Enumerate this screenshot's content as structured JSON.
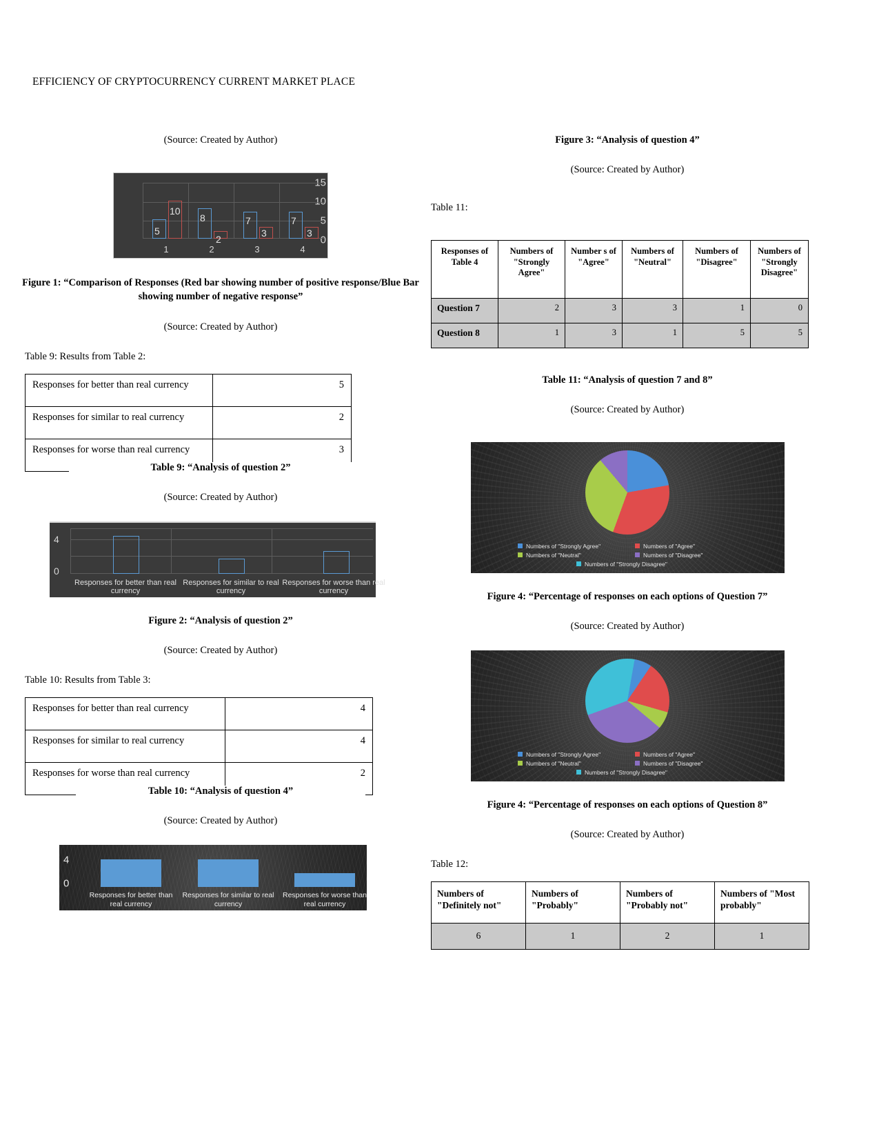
{
  "document": {
    "header": "EFFICIENCY OF CRYPTOCURRENCY CURRENT MARKET PLACE",
    "source_note": "(Source: Created by Author)"
  },
  "left": {
    "source_top": "(Source: Created by Author)",
    "figure1_caption": "Figure 1: “Comparison of Responses (Red bar showing number of positive response/Blue Bar showing number of negative response”",
    "figure1_source": "(Source: Created by Author)",
    "table9_label": "Table 9:  Results from Table 2:",
    "table9_caption": "Table 9: “Analysis of question 2”",
    "table9_source": "(Source: Created by Author)",
    "table9_rows": [
      {
        "label": "Responses for better than real currency",
        "value": "5"
      },
      {
        "label": "Responses for similar to real currency",
        "value": "2"
      },
      {
        "label": "Responses for worse than real currency",
        "value": "3"
      }
    ],
    "figure2_caption": "Figure 2: “Analysis of question 2”",
    "figure2_source": "(Source: Created by Author)",
    "table10_label": "Table 10: Results from Table 3:",
    "table10_caption": "Table 10: “Analysis of question 4”",
    "table10_source": "(Source: Created by Author)",
    "table10_rows": [
      {
        "label": "Responses for better than real currency",
        "value": "4"
      },
      {
        "label": "Responses for similar to real currency",
        "value": "4"
      },
      {
        "label": "Responses for worse than real currency",
        "value": "2"
      }
    ]
  },
  "right": {
    "figure3_title": "Figure 3: “Analysis of question 4”",
    "figure3_source": "(Source: Created by Author)",
    "table11_label": "Table 11:",
    "table11_caption": "Table 11: “Analysis of question 7 and 8”",
    "table11_source": "(Source: Created by Author)",
    "table11_headers": [
      "Responses of Table 4",
      "Numbers of \"Strongly Agree\"",
      "Number s of \"Agree\"",
      "Numbers of \"Neutral\"",
      "Numbers of \"Disagree\"",
      "Numbers of \"Strongly Disagree\""
    ],
    "table11_rows": [
      {
        "label": "Question 7",
        "values": [
          "2",
          "3",
          "3",
          "1",
          "0"
        ]
      },
      {
        "label": "Question 8",
        "values": [
          "1",
          "3",
          "1",
          "5",
          "5"
        ]
      }
    ],
    "figure4a_caption": "Figure 4: “Percentage of responses on each options of Question 7”",
    "figure4a_source": "(Source: Created by Author)",
    "figure4b_caption": "Figure 4: “Percentage of responses on each options of Question 8”",
    "figure4b_source": "(Source: Created by Author)",
    "table12_label": "Table 12:",
    "table12_headers": [
      "Numbers of \"Definitely not\"",
      "Numbers of \"Probably\"",
      "Numbers of \"Probably not\"",
      "Numbers of \"Most probably\""
    ],
    "table12_values": [
      "6",
      "1",
      "2",
      "1"
    ]
  },
  "chart_data": [
    {
      "id": "figure1",
      "type": "bar",
      "title": "Comparison of Responses",
      "categories": [
        "1",
        "2",
        "3",
        "4"
      ],
      "series": [
        {
          "name": "Blue Bar (negative response)",
          "color": "#5b9bd5",
          "values": [
            5,
            8,
            7,
            7
          ]
        },
        {
          "name": "Red bar (positive response)",
          "color": "#c0504d",
          "values": [
            10,
            2,
            3,
            3
          ]
        }
      ],
      "ylim": [
        0,
        15
      ],
      "yticks": [
        "0",
        "5",
        "10",
        "15"
      ],
      "xlabel": "",
      "ylabel": "",
      "grid": true,
      "background": "#3a3a3a"
    },
    {
      "id": "figure2",
      "type": "bar",
      "title": "Analysis of question 2",
      "categories": [
        "Responses for better than real currency",
        "Responses for similar to real currency",
        "Responses for worse than real currency"
      ],
      "values": [
        5,
        2,
        3
      ],
      "ylim": [
        0,
        6
      ],
      "yticks": [
        "0",
        "4"
      ],
      "color": "#5b9bd5",
      "grid": true,
      "background": "#3a3a3a"
    },
    {
      "id": "figure3",
      "type": "bar",
      "title": "Analysis of question 4",
      "categories": [
        "Responses for better than real currency",
        "Responses for similar to real currency",
        "Responses for worse than real currency"
      ],
      "values": [
        4,
        4,
        2
      ],
      "ylim": [
        0,
        5
      ],
      "yticks": [
        "0",
        "4"
      ],
      "color": "#5b9bd5",
      "grid": false,
      "background": "#2f2f2f"
    },
    {
      "id": "figure4a",
      "type": "pie",
      "title": "Percentage of responses on each options of Question 7",
      "labels": [
        "Numbers of \"Strongly Agree\"",
        "Numbers of \"Agree\"",
        "Numbers of \"Neutral\"",
        "Numbers of \"Disagree\"",
        "Numbers of \"Strongly Disagree\""
      ],
      "values": [
        2,
        3,
        3,
        1,
        0
      ],
      "colors": [
        "#4a90d9",
        "#e04c4c",
        "#a8cc4a",
        "#8b6fc4",
        "#3fc0d8"
      ],
      "legend_position": "bottom"
    },
    {
      "id": "figure4b",
      "type": "pie",
      "title": "Percentage of responses on each options of Question 8",
      "labels": [
        "Numbers of \"Strongly Agree\"",
        "Numbers of \"Agree\"",
        "Numbers of \"Neutral\"",
        "Numbers of \"Disagree\"",
        "Numbers of \"Strongly Disagree\""
      ],
      "values": [
        1,
        3,
        1,
        5,
        5
      ],
      "colors": [
        "#4a90d9",
        "#e04c4c",
        "#a8cc4a",
        "#8b6fc4",
        "#3fc0d8"
      ],
      "legend_position": "bottom"
    }
  ]
}
